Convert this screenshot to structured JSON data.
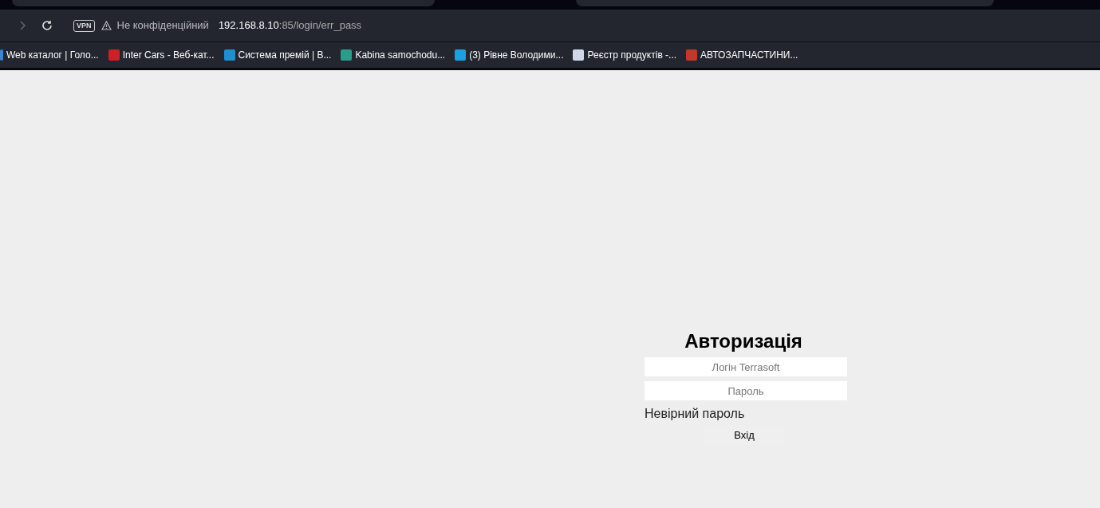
{
  "toolbar": {
    "vpn_badge": "VPN",
    "security_label": "Не конфіденційний",
    "url_host": "192.168.8.10",
    "url_path": ":85/login/err_pass"
  },
  "bookmarks": [
    {
      "label": "Web каталог | Голо..."
    },
    {
      "label": "Inter Cars - Веб-кат..."
    },
    {
      "label": "Система премій | В..."
    },
    {
      "label": "Kabina samochodu..."
    },
    {
      "label": "(3) Рівне Володими..."
    },
    {
      "label": "Реєстр продуктів -..."
    },
    {
      "label": "АВТОЗАПЧАСТИНИ..."
    }
  ],
  "login": {
    "title": "Авторизація",
    "login_field": {
      "placeholder": "Логін Terrasoft"
    },
    "password_field": {
      "placeholder": "Пароль"
    },
    "error": "Невірний пароль",
    "submit": "Вхід"
  }
}
